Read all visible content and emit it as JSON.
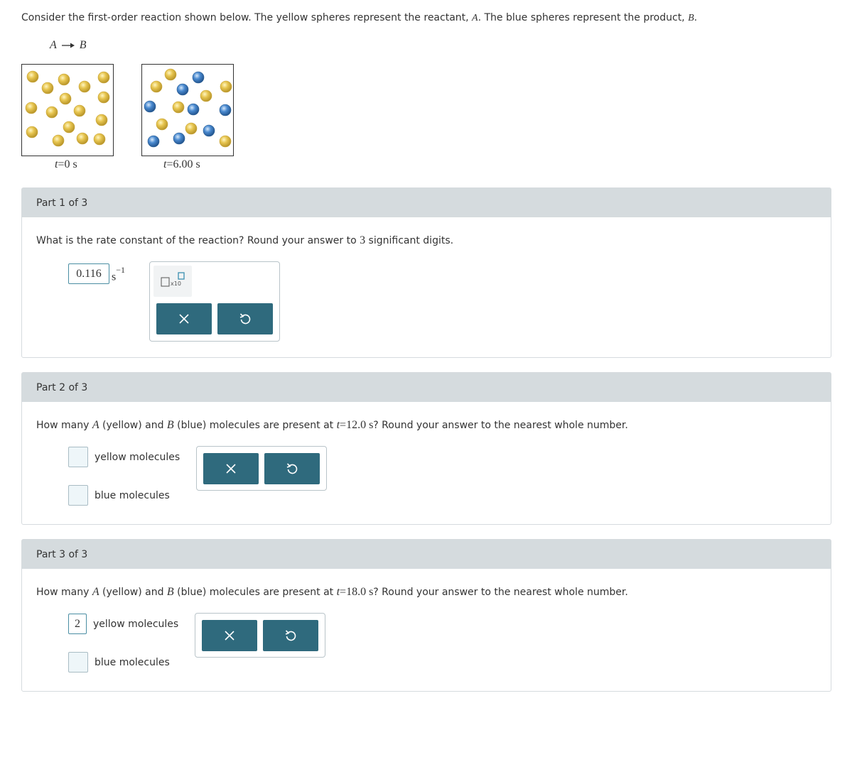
{
  "intro": {
    "text_a": "Consider the first-order reaction shown below. The yellow spheres represent the reactant, ",
    "reactant": "A",
    "text_b": ". The blue spheres represent the product, ",
    "product": "B",
    "text_c": "."
  },
  "reaction": {
    "reactant": "A",
    "product": "B"
  },
  "snapshots": [
    {
      "t_var": "t",
      "t_eq": "=0 s"
    },
    {
      "t_var": "t",
      "t_eq": "=6.00 s"
    }
  ],
  "colors": {
    "reactant": "#e3c24c",
    "product": "#3f7fbf",
    "header_bg": "#d5dbde",
    "button_bg": "#2f6a7d"
  },
  "part1": {
    "header": "Part 1 of 3",
    "question_a": "What is the rate constant of the reaction? Round your answer to ",
    "question_num": "3",
    "question_b": " significant digits.",
    "answer_value": "0.116",
    "unit": "s",
    "unit_exp": "−1",
    "tool_label": "x10",
    "clear_icon": "close-icon",
    "undo_icon": "undo-icon"
  },
  "part2": {
    "header": "Part 2 of 3",
    "question_a": "How many ",
    "var_a": "A",
    "question_b": " (yellow) and ",
    "var_b": "B",
    "question_c": " (blue) molecules are present at ",
    "t_var": "t",
    "t_eq": "=12.0 s",
    "question_d": "? Round your answer to the nearest whole number.",
    "yellow_value": "",
    "yellow_label": "yellow molecules",
    "blue_value": "",
    "blue_label": "blue molecules"
  },
  "part3": {
    "header": "Part 3 of 3",
    "question_a": "How many ",
    "var_a": "A",
    "question_b": " (yellow) and ",
    "var_b": "B",
    "question_c": " (blue) molecules are present at ",
    "t_var": "t",
    "t_eq": "=18.0 s",
    "question_d": "? Round your answer to the nearest whole number.",
    "yellow_value": "2",
    "yellow_label": "yellow molecules",
    "blue_value": "",
    "blue_label": "blue molecules"
  }
}
